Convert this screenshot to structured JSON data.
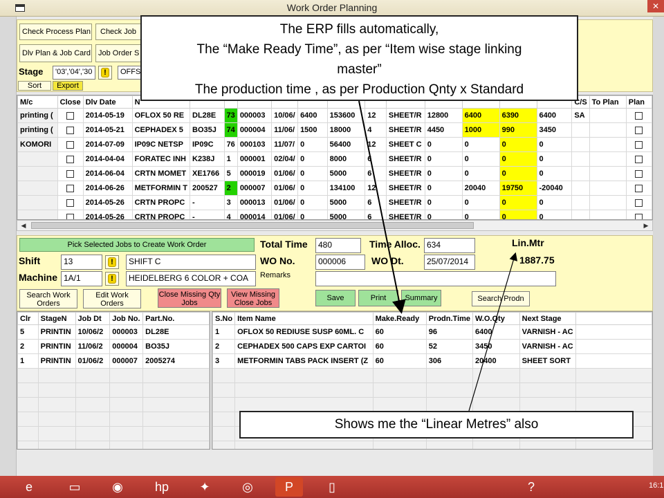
{
  "window": {
    "title": "Work Order Planning",
    "close_glyph": "✕"
  },
  "top_panel": {
    "buttons": {
      "check_process_plan": "Check Process Plan",
      "check_job": "Check Job",
      "dlv_plan_job_card": "Dlv Plan & Job Card",
      "job_order": "Job Order S"
    },
    "stage_label": "Stage",
    "stage_value": "'03','04','30",
    "stage_field2": "OFFS",
    "sort": "Sort",
    "export": "Export"
  },
  "grid_top": {
    "columns": [
      "M/c",
      "Close",
      "Dlv Date",
      "N",
      "",
      "",
      "",
      "",
      "",
      "",
      "",
      "",
      "",
      "",
      "",
      "",
      "C/S",
      "To Plan",
      "Plan"
    ],
    "rows": [
      {
        "mc": "printing (",
        "dlv": "2014-05-19",
        "item": "OFLOX 50 RE",
        "part": "DL28E",
        "lvl": "73",
        "job": "000003",
        "dt": "10/06/",
        "q1": "6400",
        "q2": "153600",
        "n": "12",
        "next": "SHEET/R",
        "q3": "12800",
        "q4": "6400",
        "q5": "6390",
        "q6": "6400",
        "cs": "SA",
        "lvl_color": "green",
        "hl": true
      },
      {
        "mc": "printing (",
        "dlv": "2014-05-21",
        "item": "CEPHADEX 5",
        "part": "BO35J",
        "lvl": "74",
        "job": "000004",
        "dt": "11/06/",
        "q1": "1500",
        "q2": "18000",
        "n": "4",
        "next": "SHEET/R",
        "q3": "4450",
        "q4": "1000",
        "q5": "990",
        "q6": "3450",
        "cs": "",
        "lvl_color": "green",
        "hl": true
      },
      {
        "mc": "KOMORI",
        "dlv": "2014-07-09",
        "item": "IP09C NETSP",
        "part": "IP09C",
        "lvl": "76",
        "job": "000103",
        "dt": "11/07/",
        "q1": "0",
        "q2": "56400",
        "n": "12",
        "next": "SHEET C",
        "q3": "0",
        "q4": "0",
        "q5": "0",
        "q6": "0",
        "cs": "",
        "lvl_color": "",
        "hl": true
      },
      {
        "mc": "",
        "dlv": "2014-04-04",
        "item": "FORATEC INH",
        "part": "K238J",
        "lvl": "1",
        "job": "000001",
        "dt": "02/04/",
        "q1": "0",
        "q2": "8000",
        "n": "6",
        "next": "SHEET/R",
        "q3": "0",
        "q4": "0",
        "q5": "0",
        "q6": "0",
        "cs": "",
        "lvl_color": "",
        "hl": true
      },
      {
        "mc": "",
        "dlv": "2014-06-04",
        "item": "CRTN MOMET",
        "part": "XE1766",
        "lvl": "5",
        "job": "000019",
        "dt": "01/06/",
        "q1": "0",
        "q2": "5000",
        "n": "6",
        "next": "SHEET/R",
        "q3": "0",
        "q4": "0",
        "q5": "0",
        "q6": "0",
        "cs": "",
        "lvl_color": "",
        "hl": true
      },
      {
        "mc": "",
        "dlv": "2014-06-26",
        "item": "METFORMIN T",
        "part": "200527",
        "lvl": "2",
        "job": "000007",
        "dt": "01/06/",
        "q1": "0",
        "q2": "134100",
        "n": "12",
        "next": "SHEET/R",
        "q3": "0",
        "q4": "20040",
        "q5": "19750",
        "q6": "-20040",
        "cs": "",
        "lvl_color": "green",
        "hl": true
      },
      {
        "mc": "",
        "dlv": "2014-05-26",
        "item": "CRTN PROPC",
        "part": "-",
        "lvl": "3",
        "job": "000013",
        "dt": "01/06/",
        "q1": "0",
        "q2": "5000",
        "n": "6",
        "next": "SHEET/R",
        "q3": "0",
        "q4": "0",
        "q5": "0",
        "q6": "0",
        "cs": "",
        "lvl_color": "",
        "hl": true
      },
      {
        "mc": "",
        "dlv": "2014-05-26",
        "item": "CRTN PROPC",
        "part": "-",
        "lvl": "4",
        "job": "000014",
        "dt": "01/06/",
        "q1": "0",
        "q2": "5000",
        "n": "6",
        "next": "SHEET/R",
        "q3": "0",
        "q4": "0",
        "q5": "0",
        "q6": "0",
        "cs": "",
        "lvl_color": "",
        "hl": true
      }
    ]
  },
  "mid_panel": {
    "pick_button": "Pick Selected Jobs to Create  Work Order",
    "shift_label": "Shift",
    "shift_code": "13",
    "shift_name": "SHIFT C",
    "machine_label": "Machine",
    "machine_code": "1A/1",
    "machine_name": "HEIDELBERG 6 COLOR + COA",
    "total_time_label": "Total Time",
    "total_time": "480",
    "time_alloc_label": "Time Alloc.",
    "time_alloc": "634",
    "wo_no_label": "WO No.",
    "wo_no": "000006",
    "wo_dt_label": "WO Dt.",
    "wo_dt": "25/07/2014",
    "remarks_label": "Remarks",
    "remarks": "",
    "lin_mtr_label": "Lin.Mtr",
    "lin_mtr": "1887.75",
    "buttons": {
      "search_work_orders": "Search Work Orders",
      "edit_work_orders": "Edit Work Orders",
      "close_missing": "Close Missing Qty Jobs",
      "view_missing": "View Missing Close Jobs",
      "save": "Save",
      "print": "Print",
      "summary": "Summary",
      "search_prodn": "Search Prodn"
    }
  },
  "grid_bottom": {
    "left_columns": [
      "Clr",
      "StageN",
      "Job Dt",
      "Job No.",
      "Part.No."
    ],
    "right_columns": [
      "S.No",
      "Item Name",
      "Make.Ready",
      "Prodn.Time",
      "W.O.Qty",
      "Next Stage"
    ],
    "rows": [
      {
        "clr": "5",
        "stage": "PRINTIN",
        "job_dt": "10/06/2",
        "job_no": "000003",
        "part": "DL28E",
        "sno": "1",
        "item": "OFLOX 50 REDIUSE SUSP 60ML. C",
        "make_ready": "60",
        "prodn": "96",
        "qty": "6400",
        "next": "VARNISH - AC"
      },
      {
        "clr": "2",
        "stage": "PRINTIN",
        "job_dt": "11/06/2",
        "job_no": "000004",
        "part": "BO35J",
        "sno": "2",
        "item": "CEPHADEX 500 CAPS EXP CARTOI",
        "make_ready": "60",
        "prodn": "52",
        "qty": "3450",
        "next": "VARNISH - AC"
      },
      {
        "clr": "1",
        "stage": "PRINTIN",
        "job_dt": "01/06/2",
        "job_no": "000007",
        "part": "2005274",
        "sno": "3",
        "item": "METFORMIN TABS PACK INSERT (Z",
        "make_ready": "60",
        "prodn": "306",
        "qty": "20400",
        "next": "SHEET SORT"
      }
    ]
  },
  "annotations": {
    "top_lines": [
      "The ERP fills automatically,",
      "The “Make Ready Time”, as per “Item wise stage linking",
      "master”",
      "The production time , as per Production Qnty x Standard"
    ],
    "bottom": "Shows me the “Linear Metres” also"
  },
  "taskbar": {
    "icons": [
      "ie-icon",
      "explorer-icon",
      "media-icon",
      "hp-icon",
      "puzzle-icon",
      "chrome-icon",
      "powerpoint-icon",
      "document-icon",
      "help-icon"
    ],
    "clock": "16:1"
  },
  "colors": {
    "panel": "#fffbc2",
    "highlight": "#ffff00",
    "green": "#23d100",
    "taskbar": "#b23a30"
  }
}
